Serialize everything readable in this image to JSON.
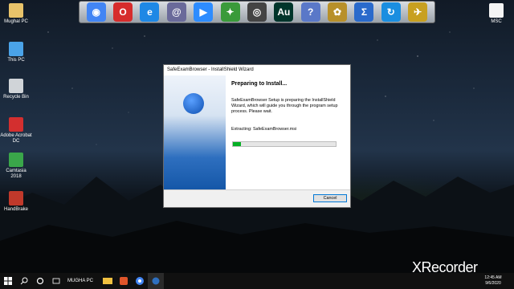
{
  "desktop": {
    "left_icons": [
      {
        "label": "Mughal PC",
        "color": "#e8c36a"
      },
      {
        "label": "This PC",
        "color": "#4aa3e8"
      },
      {
        "label": "Recycle Bin",
        "color": "#d0d4d8"
      },
      {
        "label": "Adobe Acrobat DC",
        "color": "#d32f2f"
      },
      {
        "label": "Camtasia 2018",
        "color": "#3aa64a"
      },
      {
        "label": "HandBrake",
        "color": "#c0392b"
      }
    ],
    "right_icons": [
      {
        "label": "MSC",
        "color": "#f4f4f4"
      }
    ]
  },
  "dock": {
    "icons": [
      {
        "name": "chrome-icon",
        "glyph": "◉",
        "color": "#4285f4"
      },
      {
        "name": "opera-icon",
        "glyph": "O",
        "color": "#d62c2c"
      },
      {
        "name": "edge-icon",
        "glyph": "e",
        "color": "#1e88e5"
      },
      {
        "name": "app-swirl-icon",
        "glyph": "@",
        "color": "#6a6a9a"
      },
      {
        "name": "zoom-icon",
        "glyph": "▶",
        "color": "#2d8cff"
      },
      {
        "name": "app-green-icon",
        "glyph": "✦",
        "color": "#3a9a3a"
      },
      {
        "name": "app-circle-icon",
        "glyph": "◎",
        "color": "#444"
      },
      {
        "name": "audition-icon",
        "glyph": "Au",
        "color": "#00352b"
      },
      {
        "name": "help-icon",
        "glyph": "?",
        "color": "#5a78c8"
      },
      {
        "name": "app-gold-icon",
        "glyph": "✿",
        "color": "#b8902a"
      },
      {
        "name": "sigma-icon",
        "glyph": "Σ",
        "color": "#2a6acb"
      },
      {
        "name": "sync-icon",
        "glyph": "↻",
        "color": "#1a8ee0"
      },
      {
        "name": "tool-icon",
        "glyph": "✈",
        "color": "#c8a020"
      }
    ]
  },
  "window": {
    "title": "SafeExamBrowser - InstallShield Wizard",
    "heading": "Preparing to Install...",
    "description": "SafeExamBrowser Setup is preparing the InstallShield Wizard, which will guide you through the program setup process. Please wait.",
    "status": "Extracting: SafeExamBrowser.msi",
    "progress_fraction": 0.08,
    "cancel_label": "Cancel"
  },
  "taskbar": {
    "search_label": "MUGHA PC",
    "time": "12:45 AM",
    "date": "9/6/2020"
  },
  "watermark": "XRecorder"
}
